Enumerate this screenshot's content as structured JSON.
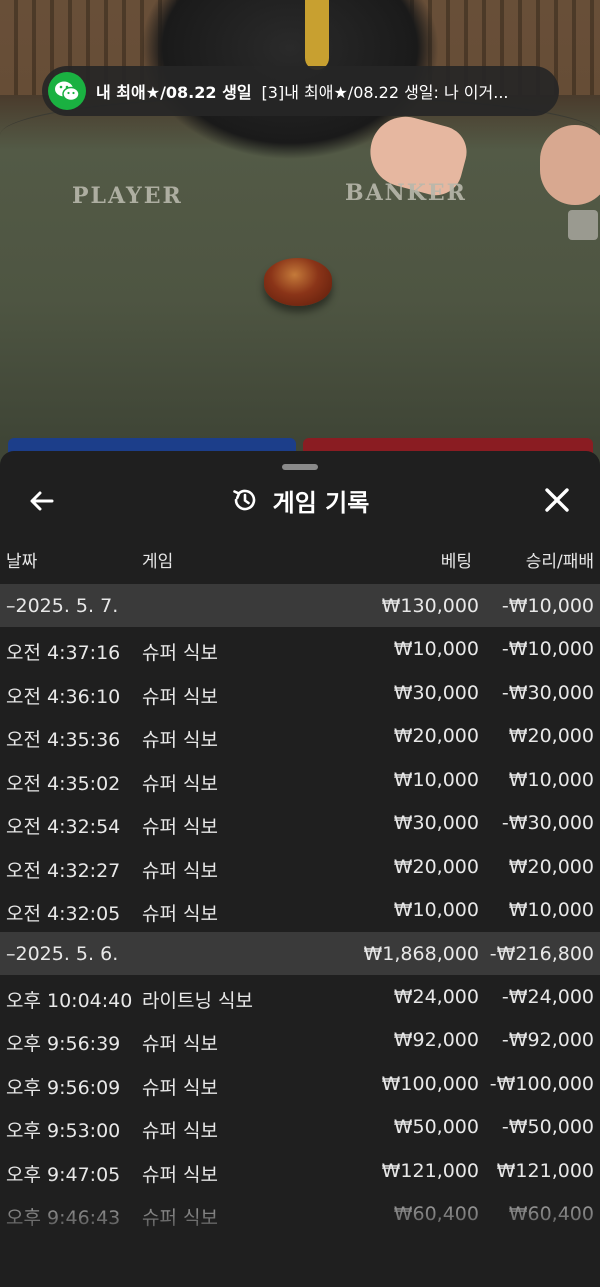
{
  "video": {
    "table_labels": {
      "player": "PLAYER",
      "banker": "BANKER"
    }
  },
  "notification": {
    "app_icon": "wechat-icon",
    "sender": "내 최애★/08.22 생일",
    "message": "[3]내 최애★/08.22 생일: 나 이거..."
  },
  "sheet": {
    "title": "게임 기록",
    "icons": {
      "back": "arrow-left-icon",
      "history": "history-icon",
      "close": "close-icon"
    },
    "columns": {
      "date": "날짜",
      "game": "게임",
      "bet": "베팅",
      "result": "승리/패배"
    },
    "groups": [
      {
        "date": "–2025. 5. 7.",
        "bet_total": "₩130,000",
        "result_total": "-₩10,000",
        "rows": [
          {
            "time": "오전 4:37:16",
            "game": "슈퍼 식보",
            "bet": "₩10,000",
            "result": "-₩10,000"
          },
          {
            "time": "오전 4:36:10",
            "game": "슈퍼 식보",
            "bet": "₩30,000",
            "result": "-₩30,000"
          },
          {
            "time": "오전 4:35:36",
            "game": "슈퍼 식보",
            "bet": "₩20,000",
            "result": "₩20,000"
          },
          {
            "time": "오전 4:35:02",
            "game": "슈퍼 식보",
            "bet": "₩10,000",
            "result": "₩10,000"
          },
          {
            "time": "오전 4:32:54",
            "game": "슈퍼 식보",
            "bet": "₩30,000",
            "result": "-₩30,000"
          },
          {
            "time": "오전 4:32:27",
            "game": "슈퍼 식보",
            "bet": "₩20,000",
            "result": "₩20,000"
          },
          {
            "time": "오전 4:32:05",
            "game": "슈퍼 식보",
            "bet": "₩10,000",
            "result": "₩10,000"
          }
        ]
      },
      {
        "date": "–2025. 5. 6.",
        "bet_total": "₩1,868,000",
        "result_total": "-₩216,800",
        "rows": [
          {
            "time": "오후 10:04:40",
            "game": "라이트닝 식보",
            "bet": "₩24,000",
            "result": "-₩24,000"
          },
          {
            "time": "오후 9:56:39",
            "game": "슈퍼 식보",
            "bet": "₩92,000",
            "result": "-₩92,000"
          },
          {
            "time": "오후 9:56:09",
            "game": "슈퍼 식보",
            "bet": "₩100,000",
            "result": "-₩100,000"
          },
          {
            "time": "오후 9:53:00",
            "game": "슈퍼 식보",
            "bet": "₩50,000",
            "result": "-₩50,000"
          },
          {
            "time": "오후 9:47:05",
            "game": "슈퍼 식보",
            "bet": "₩121,000",
            "result": "₩121,000"
          },
          {
            "time": "오후 9:46:43",
            "game": "슈퍼 식보",
            "bet": "₩60,400",
            "result": "₩60,400"
          }
        ]
      }
    ]
  }
}
